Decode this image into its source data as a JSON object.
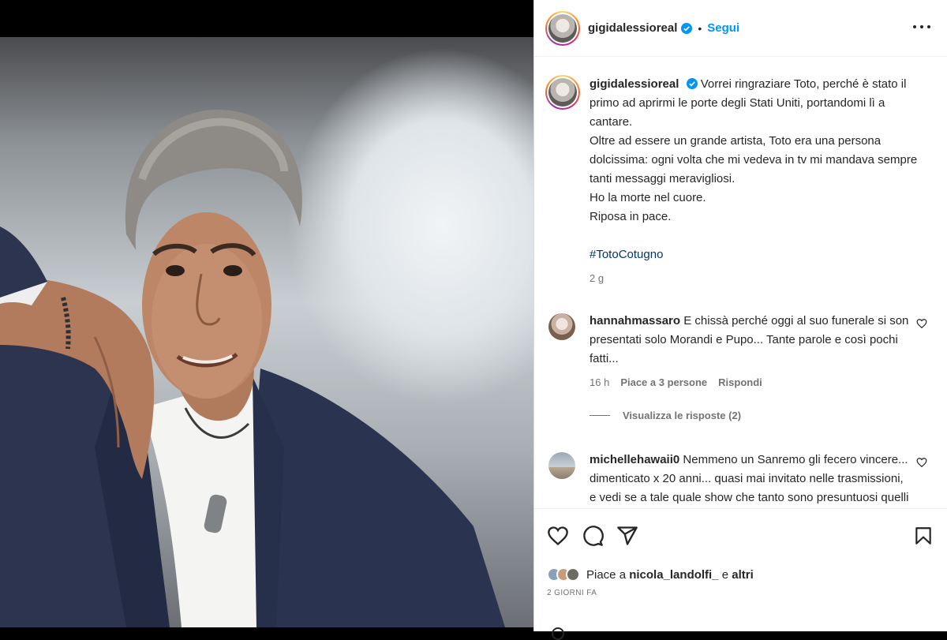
{
  "post": {
    "username": "gigidalessioreal",
    "separator": "•",
    "follow_label": "Segui",
    "caption_lines": [
      "Vorrei ringraziare Toto, perché è stato il",
      "primo ad aprirmi le porte degli Stati Uniti, portandomi lì a",
      "cantare.",
      "Oltre ad essere un grande artista, Toto era una persona",
      "dolcissima: ogni volta che mi vedeva in tv mi mandava sempre",
      "tanti messaggi meravigliosi.",
      "Ho la morte nel cuore.",
      "Riposa in pace."
    ],
    "hashtag": "#TotoCotugno",
    "caption_time": "2 g"
  },
  "comments": [
    {
      "username": "hannahmassaro",
      "lines": [
        "E chissà perché oggi al suo funerale si son",
        "presentati solo Morandi e Pupo... Tante parole e così pochi",
        "fatti..."
      ],
      "time": "16 h",
      "likes": "Piace a 3 persone",
      "reply_label": "Rispondi",
      "view_replies": "Visualizza le risposte (2)"
    },
    {
      "username": "michellehawaii0",
      "lines": [
        "Nemmeno un Sanremo gli fecero vincere...",
        "dimenticato x 20 anni... quasi mai invitato nelle trasmissioni,",
        "e vedi se a tale quale show che tanto sono presuntuosi quelli"
      ]
    }
  ],
  "footer": {
    "likes_prefix": "Piace a ",
    "likes_user": "nicola_landolfi_",
    "likes_suffix_and": " e ",
    "likes_others": "altri",
    "date": "2 GIORNI FA"
  },
  "icons": {
    "like": "heart-icon",
    "comment": "comment-icon",
    "share": "share-icon",
    "save": "bookmark-icon",
    "more": "more-options-icon",
    "verified": "verified-badge-icon"
  },
  "colors": {
    "accent": "#0095f6",
    "hashtag": "#00376b",
    "verified": "#0095f6",
    "muted": "#737373"
  }
}
